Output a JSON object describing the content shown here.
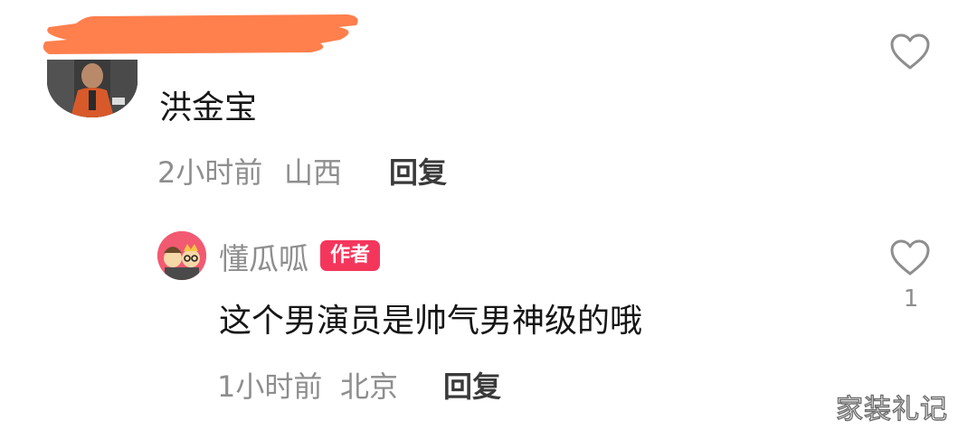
{
  "comments": [
    {
      "text": "洪金宝",
      "time": "2小时前",
      "location": "山西",
      "reply_label": "回复"
    },
    {
      "username": "懂瓜呱",
      "badge": "作者",
      "text": "这个男演员是帅气男神级的哦",
      "time": "1小时前",
      "location": "北京",
      "reply_label": "回复",
      "like_count": "1"
    }
  ],
  "icons": {
    "like": "heart-outline-icon"
  },
  "colors": {
    "badge": "#f5365c",
    "redaction": "#ff7f4d",
    "meta_text": "#8e8e8e"
  },
  "watermark": "家装礼记"
}
